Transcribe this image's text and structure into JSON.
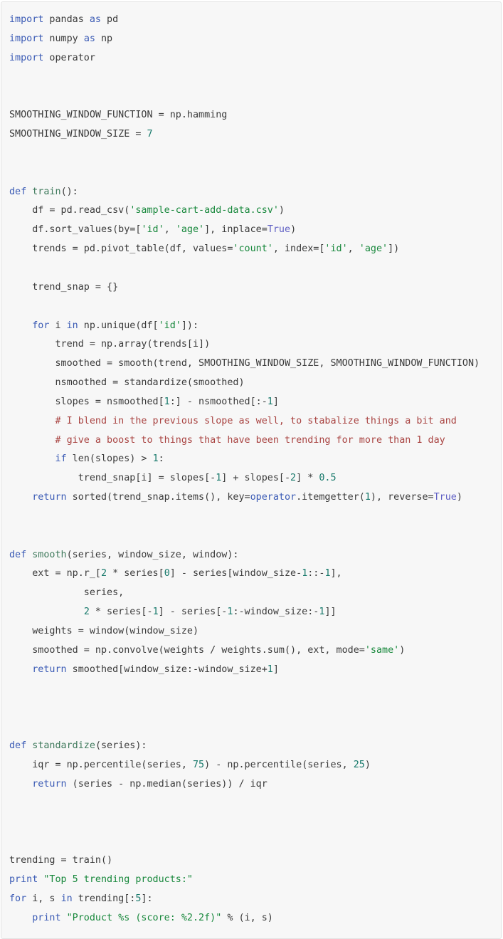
{
  "code_block": {
    "language": "python",
    "theme": {
      "background": "#f7f7f7",
      "border": "#e3e3e3",
      "default_text": "#3a3a3a",
      "keyword": "#3b5bb5",
      "constant": "#5f5fc4",
      "string": "#18883c",
      "comment": "#a94442",
      "number": "#17796b",
      "function_name": "#3f7a5c"
    },
    "lines": [
      {
        "n": 1,
        "tokens": [
          {
            "t": "import",
            "c": "k"
          },
          {
            "t": " pandas ",
            "c": "p"
          },
          {
            "t": "as",
            "c": "k"
          },
          {
            "t": " pd",
            "c": "p"
          }
        ]
      },
      {
        "n": 2,
        "tokens": [
          {
            "t": "import",
            "c": "k"
          },
          {
            "t": " numpy ",
            "c": "p"
          },
          {
            "t": "as",
            "c": "k"
          },
          {
            "t": " np",
            "c": "p"
          }
        ]
      },
      {
        "n": 3,
        "tokens": [
          {
            "t": "import",
            "c": "k"
          },
          {
            "t": " operator",
            "c": "p"
          }
        ]
      },
      {
        "n": 4,
        "tokens": []
      },
      {
        "n": 5,
        "tokens": []
      },
      {
        "n": 6,
        "tokens": [
          {
            "t": "SMOOTHING_WINDOW_FUNCTION = np.hamming",
            "c": "p"
          }
        ]
      },
      {
        "n": 7,
        "tokens": [
          {
            "t": "SMOOTHING_WINDOW_SIZE = ",
            "c": "p"
          },
          {
            "t": "7",
            "c": "n"
          }
        ]
      },
      {
        "n": 8,
        "tokens": []
      },
      {
        "n": 9,
        "tokens": []
      },
      {
        "n": 10,
        "tokens": [
          {
            "t": "def",
            "c": "k"
          },
          {
            "t": " ",
            "c": "p"
          },
          {
            "t": "train",
            "c": "fn"
          },
          {
            "t": "():",
            "c": "p"
          }
        ]
      },
      {
        "n": 11,
        "tokens": [
          {
            "t": "    df = pd.read_csv(",
            "c": "p"
          },
          {
            "t": "'sample-cart-add-data.csv'",
            "c": "s"
          },
          {
            "t": ")",
            "c": "p"
          }
        ]
      },
      {
        "n": 12,
        "tokens": [
          {
            "t": "    df.sort_values(by=[",
            "c": "p"
          },
          {
            "t": "'id'",
            "c": "s"
          },
          {
            "t": ", ",
            "c": "p"
          },
          {
            "t": "'age'",
            "c": "s"
          },
          {
            "t": "], inplace=",
            "c": "p"
          },
          {
            "t": "True",
            "c": "kc"
          },
          {
            "t": ")",
            "c": "p"
          }
        ]
      },
      {
        "n": 13,
        "tokens": [
          {
            "t": "    trends = pd.pivot_table(df, values=",
            "c": "p"
          },
          {
            "t": "'count'",
            "c": "s"
          },
          {
            "t": ", index=[",
            "c": "p"
          },
          {
            "t": "'id'",
            "c": "s"
          },
          {
            "t": ", ",
            "c": "p"
          },
          {
            "t": "'age'",
            "c": "s"
          },
          {
            "t": "])",
            "c": "p"
          }
        ]
      },
      {
        "n": 14,
        "tokens": []
      },
      {
        "n": 15,
        "tokens": [
          {
            "t": "    trend_snap = {}",
            "c": "p"
          }
        ]
      },
      {
        "n": 16,
        "tokens": []
      },
      {
        "n": 17,
        "tokens": [
          {
            "t": "    ",
            "c": "p"
          },
          {
            "t": "for",
            "c": "k"
          },
          {
            "t": " i ",
            "c": "p"
          },
          {
            "t": "in",
            "c": "k"
          },
          {
            "t": " np.unique(df[",
            "c": "p"
          },
          {
            "t": "'id'",
            "c": "s"
          },
          {
            "t": "]):",
            "c": "p"
          }
        ]
      },
      {
        "n": 18,
        "tokens": [
          {
            "t": "        trend = np.array(trends[i])",
            "c": "p"
          }
        ]
      },
      {
        "n": 19,
        "tokens": [
          {
            "t": "        smoothed = smooth(trend, SMOOTHING_WINDOW_SIZE, SMOOTHING_WINDOW_FUNCTION)",
            "c": "p"
          }
        ]
      },
      {
        "n": 20,
        "tokens": [
          {
            "t": "        nsmoothed = standardize(smoothed)",
            "c": "p"
          }
        ]
      },
      {
        "n": 21,
        "tokens": [
          {
            "t": "        slopes = nsmoothed[",
            "c": "p"
          },
          {
            "t": "1",
            "c": "n"
          },
          {
            "t": ":] - nsmoothed[:-",
            "c": "p"
          },
          {
            "t": "1",
            "c": "n"
          },
          {
            "t": "]",
            "c": "p"
          }
        ]
      },
      {
        "n": 22,
        "tokens": [
          {
            "t": "        # I blend in the previous slope as well, to stabalize things a bit and",
            "c": "c"
          }
        ]
      },
      {
        "n": 23,
        "tokens": [
          {
            "t": "        # give a boost to things that have been trending for more than 1 day",
            "c": "c"
          }
        ]
      },
      {
        "n": 24,
        "tokens": [
          {
            "t": "        ",
            "c": "p"
          },
          {
            "t": "if",
            "c": "k"
          },
          {
            "t": " len(slopes) > ",
            "c": "p"
          },
          {
            "t": "1",
            "c": "n"
          },
          {
            "t": ":",
            "c": "p"
          }
        ]
      },
      {
        "n": 25,
        "tokens": [
          {
            "t": "            trend_snap[i] = slopes[-",
            "c": "p"
          },
          {
            "t": "1",
            "c": "n"
          },
          {
            "t": "] + slopes[-",
            "c": "p"
          },
          {
            "t": "2",
            "c": "n"
          },
          {
            "t": "] * ",
            "c": "p"
          },
          {
            "t": "0.5",
            "c": "n"
          }
        ]
      },
      {
        "n": 26,
        "tokens": [
          {
            "t": "    ",
            "c": "p"
          },
          {
            "t": "return",
            "c": "k"
          },
          {
            "t": " sorted(trend_snap.items(), key=",
            "c": "p"
          },
          {
            "t": "operator",
            "c": "mod"
          },
          {
            "t": ".itemgetter(",
            "c": "p"
          },
          {
            "t": "1",
            "c": "n"
          },
          {
            "t": "), reverse=",
            "c": "p"
          },
          {
            "t": "True",
            "c": "kc"
          },
          {
            "t": ")",
            "c": "p"
          }
        ]
      },
      {
        "n": 27,
        "tokens": []
      },
      {
        "n": 28,
        "tokens": []
      },
      {
        "n": 29,
        "tokens": [
          {
            "t": "def",
            "c": "k"
          },
          {
            "t": " ",
            "c": "p"
          },
          {
            "t": "smooth",
            "c": "fn"
          },
          {
            "t": "(series, window_size, window):",
            "c": "p"
          }
        ]
      },
      {
        "n": 30,
        "tokens": [
          {
            "t": "    ext = np.r_[",
            "c": "p"
          },
          {
            "t": "2",
            "c": "n"
          },
          {
            "t": " * series[",
            "c": "p"
          },
          {
            "t": "0",
            "c": "n"
          },
          {
            "t": "] - series[window_size-",
            "c": "p"
          },
          {
            "t": "1",
            "c": "n"
          },
          {
            "t": "::-",
            "c": "p"
          },
          {
            "t": "1",
            "c": "n"
          },
          {
            "t": "],",
            "c": "p"
          }
        ]
      },
      {
        "n": 31,
        "tokens": [
          {
            "t": "             series,",
            "c": "p"
          }
        ]
      },
      {
        "n": 32,
        "tokens": [
          {
            "t": "             ",
            "c": "p"
          },
          {
            "t": "2",
            "c": "n"
          },
          {
            "t": " * series[-",
            "c": "p"
          },
          {
            "t": "1",
            "c": "n"
          },
          {
            "t": "] - series[-",
            "c": "p"
          },
          {
            "t": "1",
            "c": "n"
          },
          {
            "t": ":-window_size:-",
            "c": "p"
          },
          {
            "t": "1",
            "c": "n"
          },
          {
            "t": "]]",
            "c": "p"
          }
        ]
      },
      {
        "n": 33,
        "tokens": [
          {
            "t": "    weights = window(window_size)",
            "c": "p"
          }
        ]
      },
      {
        "n": 34,
        "tokens": [
          {
            "t": "    smoothed = np.convolve(weights / weights.sum(), ext, mode=",
            "c": "p"
          },
          {
            "t": "'same'",
            "c": "s"
          },
          {
            "t": ")",
            "c": "p"
          }
        ]
      },
      {
        "n": 35,
        "tokens": [
          {
            "t": "    ",
            "c": "p"
          },
          {
            "t": "return",
            "c": "k"
          },
          {
            "t": " smoothed[window_size:-window_size+",
            "c": "p"
          },
          {
            "t": "1",
            "c": "n"
          },
          {
            "t": "]",
            "c": "p"
          }
        ]
      },
      {
        "n": 36,
        "tokens": []
      },
      {
        "n": 37,
        "tokens": []
      },
      {
        "n": 38,
        "tokens": []
      },
      {
        "n": 39,
        "tokens": [
          {
            "t": "def",
            "c": "k"
          },
          {
            "t": " ",
            "c": "p"
          },
          {
            "t": "standardize",
            "c": "fn"
          },
          {
            "t": "(series):",
            "c": "p"
          }
        ]
      },
      {
        "n": 40,
        "tokens": [
          {
            "t": "    iqr = np.percentile(series, ",
            "c": "p"
          },
          {
            "t": "75",
            "c": "n"
          },
          {
            "t": ") - np.percentile(series, ",
            "c": "p"
          },
          {
            "t": "25",
            "c": "n"
          },
          {
            "t": ")",
            "c": "p"
          }
        ]
      },
      {
        "n": 41,
        "tokens": [
          {
            "t": "    ",
            "c": "p"
          },
          {
            "t": "return",
            "c": "k"
          },
          {
            "t": " (series - np.median(series)) / iqr",
            "c": "p"
          }
        ]
      },
      {
        "n": 42,
        "tokens": []
      },
      {
        "n": 43,
        "tokens": []
      },
      {
        "n": 44,
        "tokens": []
      },
      {
        "n": 45,
        "tokens": [
          {
            "t": "trending = train()",
            "c": "p"
          }
        ]
      },
      {
        "n": 46,
        "tokens": [
          {
            "t": "print",
            "c": "k"
          },
          {
            "t": " ",
            "c": "p"
          },
          {
            "t": "\"Top 5 trending products:\"",
            "c": "s"
          }
        ]
      },
      {
        "n": 47,
        "tokens": [
          {
            "t": "for",
            "c": "k"
          },
          {
            "t": " i, s ",
            "c": "p"
          },
          {
            "t": "in",
            "c": "k"
          },
          {
            "t": " trending[:",
            "c": "p"
          },
          {
            "t": "5",
            "c": "n"
          },
          {
            "t": "]:",
            "c": "p"
          }
        ]
      },
      {
        "n": 48,
        "tokens": [
          {
            "t": "    ",
            "c": "p"
          },
          {
            "t": "print",
            "c": "k"
          },
          {
            "t": " ",
            "c": "p"
          },
          {
            "t": "\"Product %s (score: %2.2f)\"",
            "c": "s"
          },
          {
            "t": " % (i, s)",
            "c": "p"
          }
        ]
      }
    ]
  }
}
